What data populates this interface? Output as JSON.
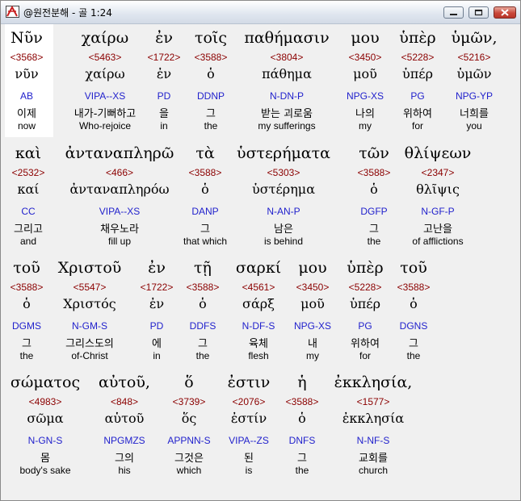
{
  "window": {
    "title": "@원전분해 - 골 1:24",
    "minimize_glyph": "▁",
    "maximize_glyph": "□",
    "close_glyph": "✕"
  },
  "rows": [
    {
      "words": [
        {
          "greek": "Νῦν",
          "strong": "<3568>",
          "lemma": "νῦν",
          "parse": "AB",
          "korean": "이제",
          "english": "now"
        },
        {
          "greek": "χαίρω",
          "strong": "<5463>",
          "lemma": "χαίρω",
          "parse": "VIPA--XS",
          "korean": "내가-기뻐하고",
          "english": "Who-rejoice"
        },
        {
          "greek": "ἐν",
          "strong": "<1722>",
          "lemma": "ἐν",
          "parse": "PD",
          "korean": "을",
          "english": "in"
        },
        {
          "greek": "τοῖς",
          "strong": "<3588>",
          "lemma": "ὁ",
          "parse": "DDNP",
          "korean": "그",
          "english": "the"
        },
        {
          "greek": "παθήμασιν",
          "strong": "<3804>",
          "lemma": "πάθημα",
          "parse": "N-DN-P",
          "korean": "받는 괴로움",
          "english": "my sufferings"
        },
        {
          "greek": "μου",
          "strong": "<3450>",
          "lemma": "μοῦ",
          "parse": "NPG-XS",
          "korean": "나의",
          "english": "my"
        },
        {
          "greek": "ὑπὲρ",
          "strong": "<5228>",
          "lemma": "ὑπέρ",
          "parse": "PG",
          "korean": "위하여",
          "english": "for"
        },
        {
          "greek": "ὑμῶν,",
          "strong": "<5216>",
          "lemma": "ὑμῶν",
          "parse": "NPG-YP",
          "korean": "너희를",
          "english": "you"
        }
      ]
    },
    {
      "words": [
        {
          "greek": "καὶ",
          "strong": "<2532>",
          "lemma": "καί",
          "parse": "CC",
          "korean": "그리고",
          "english": "and"
        },
        {
          "greek": "ἀνταναπληρῶ",
          "strong": "<466>",
          "lemma": "ἀνταναπληρόω",
          "parse": "VIPA--XS",
          "korean": "채우노라",
          "english": "fill up"
        },
        {
          "greek": "τὰ",
          "strong": "<3588>",
          "lemma": "ὁ",
          "parse": "DANP",
          "korean": "그",
          "english": "that which"
        },
        {
          "greek": "ὑστερήματα",
          "strong": "<5303>",
          "lemma": "ὑστέρημα",
          "parse": "N-AN-P",
          "korean": "남은",
          "english": "is behind"
        },
        {
          "greek": "τῶν",
          "strong": "<3588>",
          "lemma": "ὁ",
          "parse": "DGFP",
          "korean": "그",
          "english": "the"
        },
        {
          "greek": "θλίψεων",
          "strong": "<2347>",
          "lemma": "θλῖψις",
          "parse": "N-GF-P",
          "korean": "고난을",
          "english": "of afflictions"
        }
      ]
    },
    {
      "words": [
        {
          "greek": "τοῦ",
          "strong": "<3588>",
          "lemma": "ὁ",
          "parse": "DGMS",
          "korean": "그",
          "english": "the"
        },
        {
          "greek": "Χριστοῦ",
          "strong": "<5547>",
          "lemma": "Χριστός",
          "parse": "N-GM-S",
          "korean": "그리스도의",
          "english": "of-Christ"
        },
        {
          "greek": "ἐν",
          "strong": "<1722>",
          "lemma": "ἐν",
          "parse": "PD",
          "korean": "에",
          "english": "in"
        },
        {
          "greek": "τῇ",
          "strong": "<3588>",
          "lemma": "ὁ",
          "parse": "DDFS",
          "korean": "그",
          "english": "the"
        },
        {
          "greek": "σαρκί",
          "strong": "<4561>",
          "lemma": "σάρξ",
          "parse": "N-DF-S",
          "korean": "육체",
          "english": "flesh"
        },
        {
          "greek": "μου",
          "strong": "<3450>",
          "lemma": "μοῦ",
          "parse": "NPG-XS",
          "korean": "내",
          "english": "my"
        },
        {
          "greek": "ὑπὲρ",
          "strong": "<5228>",
          "lemma": "ὑπέρ",
          "parse": "PG",
          "korean": "위하여",
          "english": "for"
        },
        {
          "greek": "τοῦ",
          "strong": "<3588>",
          "lemma": "ὁ",
          "parse": "DGNS",
          "korean": "그",
          "english": "the"
        }
      ]
    },
    {
      "words": [
        {
          "greek": "σώματος",
          "strong": "<4983>",
          "lemma": "σῶμα",
          "parse": "N-GN-S",
          "korean": "몸",
          "english": "body's sake"
        },
        {
          "greek": "αὐτοῦ,",
          "strong": "<848>",
          "lemma": "αὑτοῦ",
          "parse": "NPGMZS",
          "korean": "그의",
          "english": "his"
        },
        {
          "greek": "ὅ",
          "strong": "<3739>",
          "lemma": "ὅς",
          "parse": "APPNN-S",
          "korean": "그것은",
          "english": "which"
        },
        {
          "greek": "ἐστιν",
          "strong": "<2076>",
          "lemma": "ἐστίν",
          "parse": "VIPA--ZS",
          "korean": "된",
          "english": "is"
        },
        {
          "greek": "ἡ",
          "strong": "<3588>",
          "lemma": "ὁ",
          "parse": "DNFS",
          "korean": "그",
          "english": "the"
        },
        {
          "greek": "ἐκκλησία,",
          "strong": "<1577>",
          "lemma": "ἐκκλησία",
          "parse": "N-NF-S",
          "korean": "교회를",
          "english": "church"
        }
      ]
    }
  ]
}
